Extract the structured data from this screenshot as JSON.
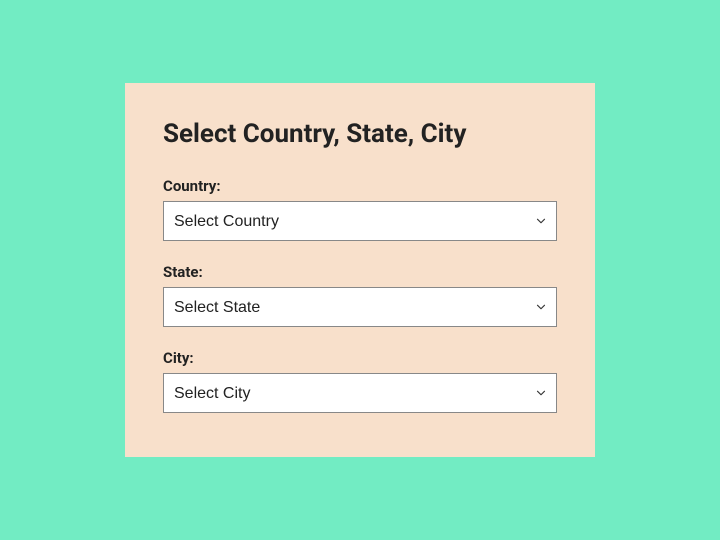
{
  "form": {
    "title": "Select Country, State, City",
    "fields": {
      "country": {
        "label": "Country:",
        "selected": "Select Country"
      },
      "state": {
        "label": "State:",
        "selected": "Select State"
      },
      "city": {
        "label": "City:",
        "selected": "Select City"
      }
    }
  }
}
